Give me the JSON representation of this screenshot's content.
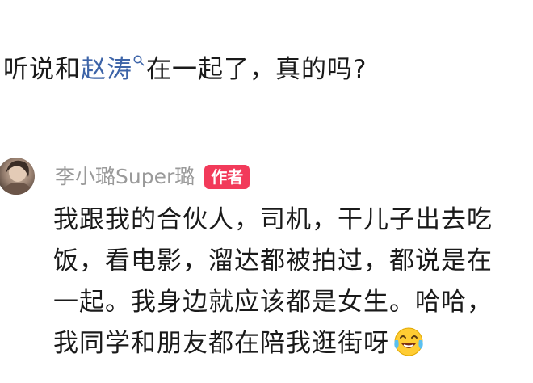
{
  "post": {
    "question_before": "听说和",
    "mention": "赵涛",
    "question_after": "在一起了，真的吗?"
  },
  "comment": {
    "author_name": "李小璐Super璐",
    "author_badge": "作者",
    "lines": [
      "我跟我的合伙人，司机，干儿子出去吃",
      "饭，看电影，溜达都被拍过，都说是在",
      "一起。我身边就应该都是女生。哈哈，",
      "我同学和朋友都在陪我逛街呀"
    ],
    "emoji": "crying-laughing-emoji"
  },
  "icons": {
    "mention_search": "search-icon"
  },
  "colors": {
    "mention_link": "#3d64a8",
    "author_name": "#9a9a9a",
    "badge_background": "#f23a5a",
    "text": "#1a1a1a"
  }
}
